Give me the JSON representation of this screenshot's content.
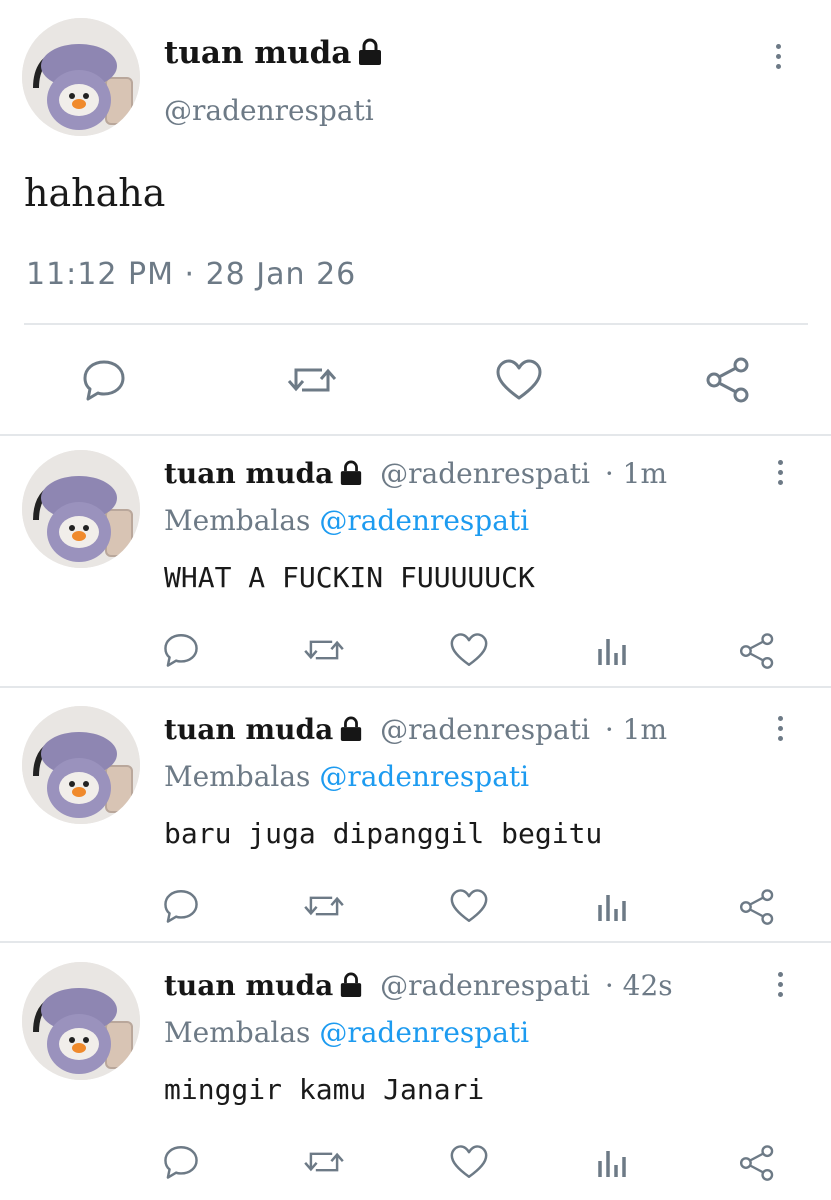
{
  "main_tweet": {
    "display_name": "tuan muda",
    "handle": "@radenrespati",
    "text": "hahaha",
    "timestamp": "11:12 PM · 28 Jan 26"
  },
  "replies": [
    {
      "display_name": "tuan muda",
      "handle": "@radenrespati",
      "age": "· 1m",
      "replying_prefix": "Membalas",
      "replying_to": "@radenrespati",
      "text": "WHAT A FUCKIN FUUUUUCK"
    },
    {
      "display_name": "tuan muda",
      "handle": "@radenrespati",
      "age": "· 1m",
      "replying_prefix": "Membalas",
      "replying_to": "@radenrespati",
      "text": "baru juga dipanggil begitu"
    },
    {
      "display_name": "tuan muda",
      "handle": "@radenrespati",
      "age": "· 42s",
      "replying_prefix": "Membalas",
      "replying_to": "@radenrespati",
      "text": "minggir kamu Janari"
    }
  ],
  "icons": {
    "reply": "reply-icon",
    "retweet": "retweet-icon",
    "like": "heart-icon",
    "views": "views-icon",
    "share": "share-icon",
    "more": "more-vertical-icon",
    "lock": "lock-icon"
  },
  "colors": {
    "icon_gray": "#6d7a86",
    "mention_blue": "#1d9bf0",
    "divider": "#e4e7ea",
    "text": "#1a1a1a"
  }
}
